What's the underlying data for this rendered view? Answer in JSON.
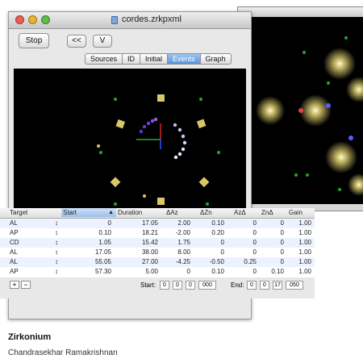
{
  "window": {
    "title": "cordes.zrkpxml"
  },
  "toolbar": {
    "stop_label": "Stop",
    "back_label": "<<",
    "v_label": "V"
  },
  "tabs": [
    {
      "label": "Sources",
      "active": false
    },
    {
      "label": "ID",
      "active": false
    },
    {
      "label": "Initial",
      "active": false
    },
    {
      "label": "Events",
      "active": true
    },
    {
      "label": "Graph",
      "active": false
    }
  ],
  "table": {
    "headers": {
      "target": "Target",
      "start": "Start",
      "duration": "Duration",
      "daz": "ΔAz",
      "dzn": "ΔZn",
      "azd": "AzΔ",
      "znd": "ZnΔ",
      "gain": "Gain"
    },
    "rows": [
      {
        "target": "AL",
        "start": "0",
        "duration": "17.05",
        "daz": "2.00",
        "dzn": "0.10",
        "azd": "0",
        "znd": "0",
        "gain": "1.00"
      },
      {
        "target": "AP",
        "start": "0.10",
        "duration": "18.21",
        "daz": "-2.00",
        "dzn": "0.20",
        "azd": "0",
        "znd": "0",
        "gain": "1.00"
      },
      {
        "target": "CD",
        "start": "1.05",
        "duration": "15.42",
        "daz": "1.75",
        "dzn": "0",
        "azd": "0",
        "znd": "0",
        "gain": "1.00"
      },
      {
        "target": "AL",
        "start": "17.05",
        "duration": "38.00",
        "daz": "8.00",
        "dzn": "0",
        "azd": "0",
        "znd": "0",
        "gain": "1.00"
      },
      {
        "target": "AL",
        "start": "55.05",
        "duration": "27.00",
        "daz": "-4.25",
        "dzn": "-0.50",
        "azd": "0.25",
        "znd": "0",
        "gain": "1.00"
      },
      {
        "target": "AP",
        "start": "57.30",
        "duration": "5.00",
        "daz": "0",
        "dzn": "0.10",
        "azd": "0",
        "znd": "0.10",
        "gain": "1.00"
      }
    ]
  },
  "footer": {
    "add_label": "+",
    "remove_label": "−",
    "start_label": "Start:",
    "start_fields": [
      "0",
      "0",
      "0",
      "000"
    ],
    "end_label": "End:",
    "end_fields": [
      "0",
      "0",
      "17",
      "050"
    ]
  },
  "caption": {
    "title": "Zirkonium",
    "author": "Chandrasekhar Ramakrishnan"
  },
  "colors": {
    "active_tab": "#5b93d9",
    "viewer_bg": "#000000",
    "speaker": "#d8c86a"
  }
}
